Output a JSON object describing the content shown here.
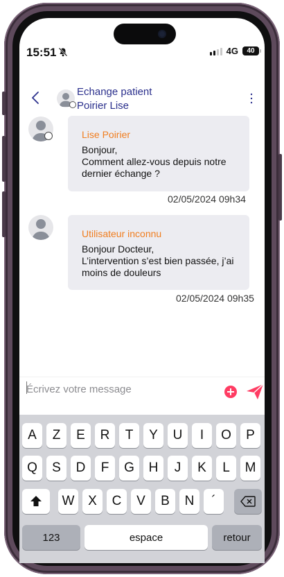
{
  "status_bar": {
    "time": "15:51",
    "network": "4G",
    "battery": "40"
  },
  "header": {
    "title": "Echange patient",
    "subtitle": "Poirier Lise"
  },
  "messages": [
    {
      "sender": "Lise Poirier",
      "text": "Bonjour,\nComment allez-vous depuis notre dernier échange ?",
      "timestamp": "02/05/2024 09h34"
    },
    {
      "sender": "Utilisateur inconnu",
      "text": "Bonjour Docteur,\nL’intervention s’est bien passée, j’ai moins de douleurs",
      "timestamp": "02/05/2024 09h35"
    }
  ],
  "composer": {
    "placeholder": "Écrivez votre message"
  },
  "keyboard": {
    "row1": [
      "A",
      "Z",
      "E",
      "R",
      "T",
      "Y",
      "U",
      "I",
      "O",
      "P"
    ],
    "row2": [
      "Q",
      "S",
      "D",
      "F",
      "G",
      "H",
      "J",
      "K",
      "L",
      "M"
    ],
    "row3": [
      "W",
      "X",
      "C",
      "V",
      "B",
      "N",
      "´"
    ],
    "numbers_label": "123",
    "space_label": "espace",
    "return_label": "retour"
  },
  "colors": {
    "accent_navy": "#2a2f8c",
    "sender_orange": "#f07d1e",
    "action_pink": "#ff3c63",
    "frame": "#5e4a5c"
  }
}
